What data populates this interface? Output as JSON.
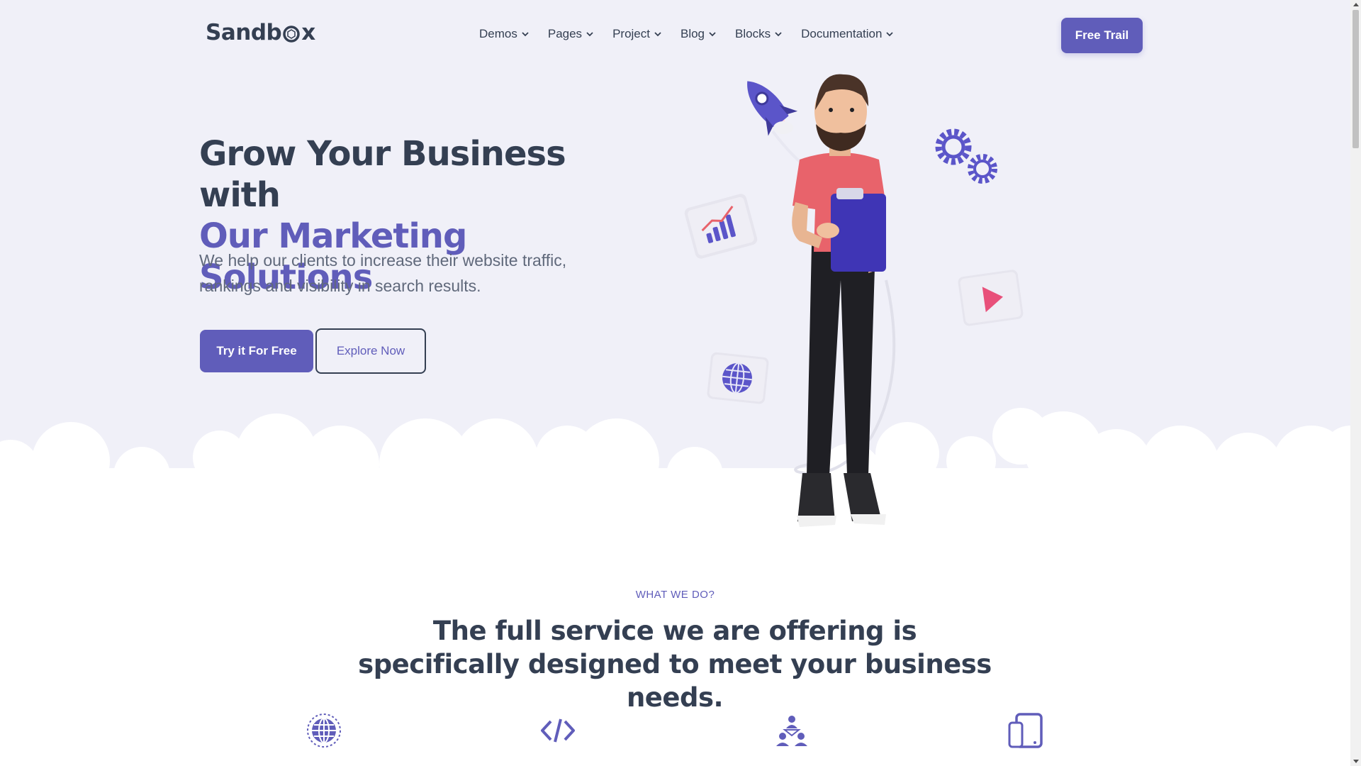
{
  "brand": {
    "name_prefix": "Sandb",
    "name_suffix": "x"
  },
  "nav": {
    "items": [
      {
        "label": "Demos"
      },
      {
        "label": "Pages"
      },
      {
        "label": "Project"
      },
      {
        "label": "Blog"
      },
      {
        "label": "Blocks"
      },
      {
        "label": "Documentation"
      }
    ],
    "cta_label": "Free Trail"
  },
  "hero": {
    "title_line1": "Grow Your Business with",
    "title_line2": "Our Marketing Solutions",
    "lead": "We help our clients to increase their website traffic, rankings and visibility in search results.",
    "primary_button": "Try it For Free",
    "secondary_button": "Explore Now"
  },
  "services": {
    "eyebrow": "WHAT WE DO?",
    "title": "The full service we are offering is specifically designed to meet your business needs.",
    "icons": [
      "globe-icon",
      "code-icon",
      "team-icon",
      "devices-icon"
    ]
  },
  "colors": {
    "accent": "#605dba",
    "heading": "#343f52",
    "body_text": "#60697b",
    "hero_background": "#f0f0f8",
    "shirt": "#e8636b"
  }
}
